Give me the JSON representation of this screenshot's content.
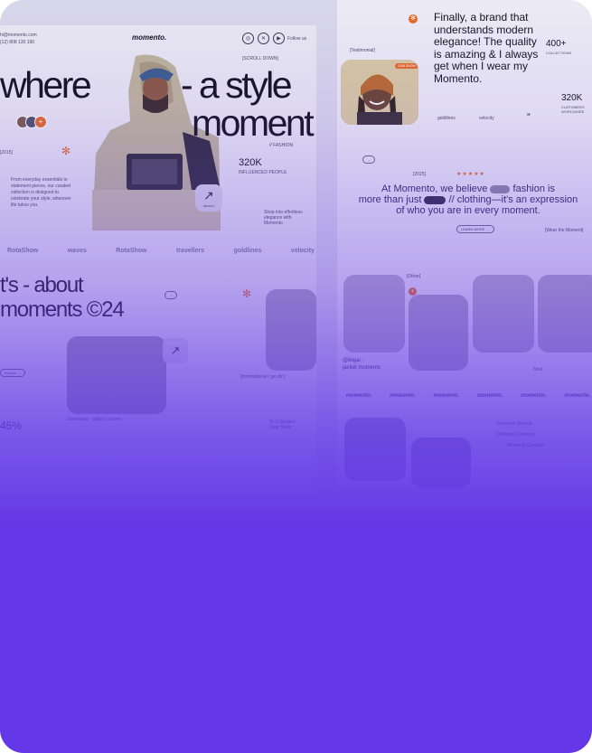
{
  "left_page": {
    "contact_email": "hi@momento.com",
    "contact_phone": "(12) 808 130 190",
    "brand": "momento.",
    "follow_label": "Follow us",
    "hero_left": "where",
    "hero_right_1": "- a style",
    "hero_right_2": "moment",
    "scroll_label": "[SCROLL DOWN]",
    "year_tag": "[2015]",
    "description": "From everyday essentials to statement pieces, our curated collection is designed to celebrate your style, wherever life takes you.",
    "fashion_tag": "// FASHION",
    "stat_value": "320K",
    "stat_label": "INFLUENCED PEOPLE",
    "search_label": "SEARCH",
    "shop_text": "Shop into effortless elegance with Momento",
    "logos": [
      "RotaShow",
      "waves",
      "RotaShow",
      "travellers",
      "goldlines",
      "velocity"
    ],
    "section_title_1": "t's - about",
    "section_title_2": "moments ©24",
    "explore_label": "explore",
    "caption_1": "[International / get dir.]",
    "caption_2": "Streetwear - gallery shower",
    "percent": "45%",
    "collaborator_label": "To Collection Date Show",
    "icons": [
      "instagram-icon",
      "x-icon",
      "youtube-icon"
    ]
  },
  "right_page": {
    "testimonial_quote": "Finally, a brand that understands modern elegance! The quality is amazing & I always get when I wear my Momento.",
    "testimonial_tag": "[Testimonial]",
    "join_badge": "JOIN SHOW",
    "stat1_value": "400+",
    "stat1_label": "COLLECTIONS",
    "stat2_value": "320K",
    "stat2_label": "CUSTOMERS WORLDWIDE",
    "partner_1": "goldlines",
    "partner_2": "velocity",
    "year": "[2025]",
    "mission_1": "At Momento, we believe",
    "mission_2": "fashion is",
    "mission_3": "more than just",
    "mission_4": "// clothing—it's an expression",
    "mission_5": "of who you are in every moment.",
    "learn_more": "LEARN MORE",
    "wear_label": "[Wear the Moment]",
    "other_label": "[Other]",
    "product_name_1": "@ikigai -",
    "product_name_2": "jacket moments",
    "next_label": "Next",
    "marquee_word": "momento.",
    "list_1": "Chronicle Director",
    "list_2": "Collection Curation",
    "list_3": "Momento Curation",
    "quote_mark": "”"
  },
  "colors": {
    "accent": "#e36b27",
    "overlay": "#6438e6"
  }
}
